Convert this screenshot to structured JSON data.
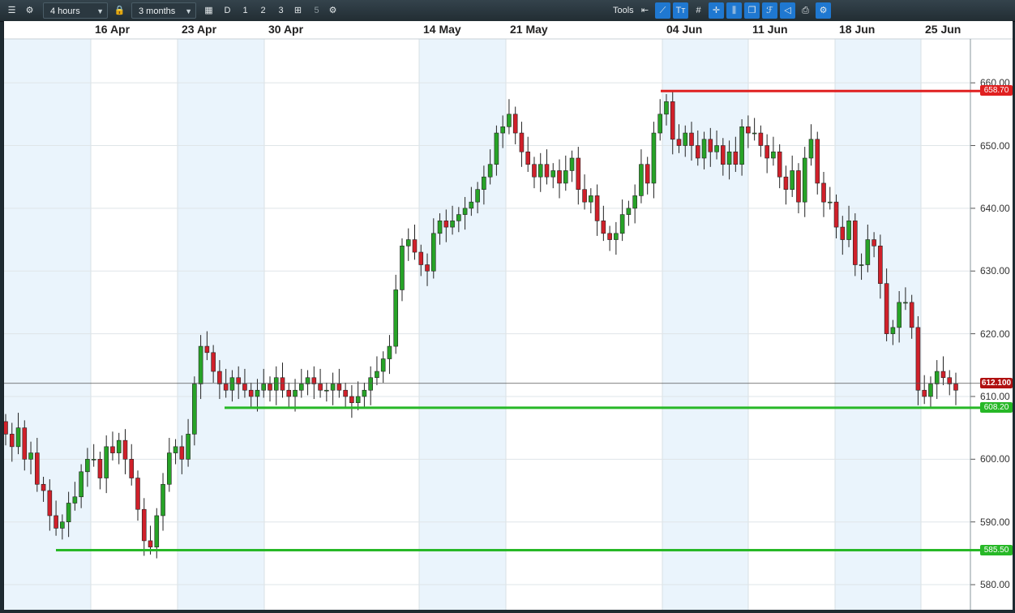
{
  "toolbar": {
    "interval": "4 hours",
    "range": "3 months",
    "period_buttons": [
      "D",
      "1",
      "2",
      "3",
      "5"
    ],
    "tools_label": "Tools",
    "icons": [
      "menu-icon",
      "settings-icon",
      "lock-icon",
      "calendar-icon",
      "drawing-icon",
      "gear-icon",
      "back-arrow-icon",
      "line-tool-icon",
      "text-tool-icon",
      "grid-icon",
      "crosshair-icon",
      "candle-tool-icon",
      "copy-icon",
      "fibonacci-icon",
      "shape-icon",
      "print-icon",
      "tools-settings-icon"
    ]
  },
  "colors": {
    "up_candle": "#27a327",
    "down_candle": "#d0202a",
    "resistance_line": "#e02020",
    "support_line": "#27b827",
    "current_price_tag": "#b01010",
    "shading": "#eaf4fc"
  },
  "chart_data": {
    "type": "candlestick",
    "interval": "4 hours",
    "range": "3 months",
    "x_ticks": [
      "16 Apr",
      "23 Apr",
      "30 Apr",
      "14 May",
      "21 May",
      "04 Jun",
      "11 Jun",
      "18 Jun",
      "25 Jun"
    ],
    "y_ticks": [
      "660.00",
      "650.00",
      "640.00",
      "630.00",
      "620.00",
      "610.00",
      "600.00",
      "590.00",
      "580.00"
    ],
    "ylim": [
      576,
      667
    ],
    "levels": [
      {
        "label": "658.70",
        "value": 658.7,
        "kind": "resistance"
      },
      {
        "label": "608.20",
        "value": 608.2,
        "kind": "support"
      },
      {
        "label": "585.50",
        "value": 585.5,
        "kind": "support"
      }
    ],
    "current_price": {
      "label": "612.100",
      "value": 612.1
    },
    "candles_close": [
      604,
      602,
      605,
      600,
      601,
      596,
      595,
      591,
      589,
      590,
      593,
      594,
      598,
      600,
      600,
      597,
      602,
      601,
      603,
      600,
      597,
      592,
      587,
      586,
      591,
      596,
      601,
      602,
      600,
      604,
      612,
      618,
      617,
      614,
      612,
      611,
      613,
      612,
      611,
      610,
      611,
      612,
      611,
      613,
      611,
      610,
      611,
      612,
      613,
      612,
      611,
      611,
      612,
      611,
      610,
      609,
      610,
      611,
      613,
      614,
      616,
      618,
      627,
      634,
      635,
      633,
      631,
      630,
      636,
      638,
      637,
      638,
      639,
      640,
      641,
      643,
      645,
      647,
      652,
      653,
      655,
      652,
      649,
      647,
      645,
      647,
      645,
      646,
      644,
      646,
      648,
      643,
      641,
      642,
      638,
      636,
      635,
      636,
      639,
      640,
      642,
      647,
      644,
      652,
      655,
      657,
      651,
      650,
      652,
      650,
      648,
      651,
      649,
      650,
      647,
      649,
      647,
      653,
      652,
      652,
      650,
      648,
      649,
      645,
      643,
      646,
      641,
      648,
      651,
      644,
      641,
      641,
      637,
      635,
      638,
      631,
      631,
      635,
      634,
      628,
      620,
      621,
      625,
      625,
      621,
      611,
      610,
      612,
      614,
      613,
      612,
      611
    ]
  }
}
